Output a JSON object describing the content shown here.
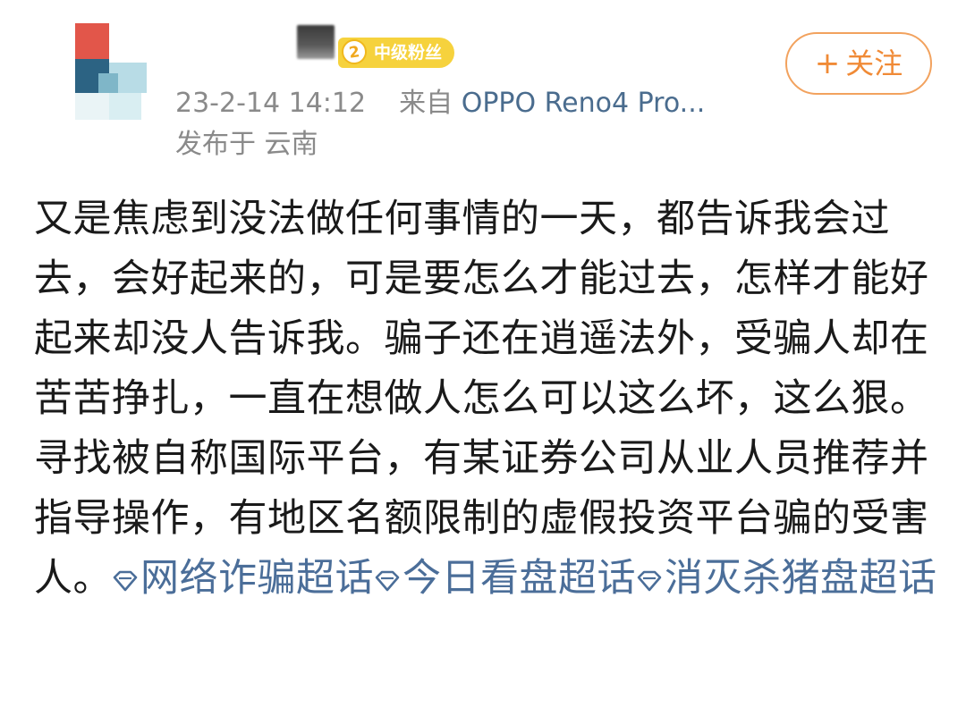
{
  "header": {
    "fan_badge": {
      "level": "2",
      "label": "中级粉丝"
    },
    "timestamp": "23-2-14 14:12",
    "source_prefix": "来自",
    "source_device": "OPPO Reno4 Pro...",
    "location": "发布于 云南",
    "follow_label": "关注",
    "follow_icon": "plus-icon"
  },
  "post": {
    "paragraph_1": "又是焦虑到没法做任何事情的一天，都告诉我会过去，会好起来的，可是要怎么才能过去，怎样才能好起来却没人告诉我。骗子还在逍遥法外，受骗人却在苦苦挣扎，一直在想做人怎么可以这么坏，这么狠。",
    "paragraph_2": "寻找被自称国际平台，有某证券公司从业人员推荐并指导操作，有地区名额限制的虚假投资平台骗的受害人。",
    "topics": [
      {
        "label": "网络诈骗超话",
        "icon": "diamond-topic-icon"
      },
      {
        "label": "今日看盘超话",
        "icon": "diamond-topic-icon"
      },
      {
        "label": "消灭杀猪盘超话",
        "icon": "diamond-topic-icon"
      }
    ]
  },
  "colors": {
    "link": "#4b6e99",
    "follow_accent": "#f08a36",
    "badge": "#f6d23d",
    "meta_gray": "#8a8a8a"
  }
}
